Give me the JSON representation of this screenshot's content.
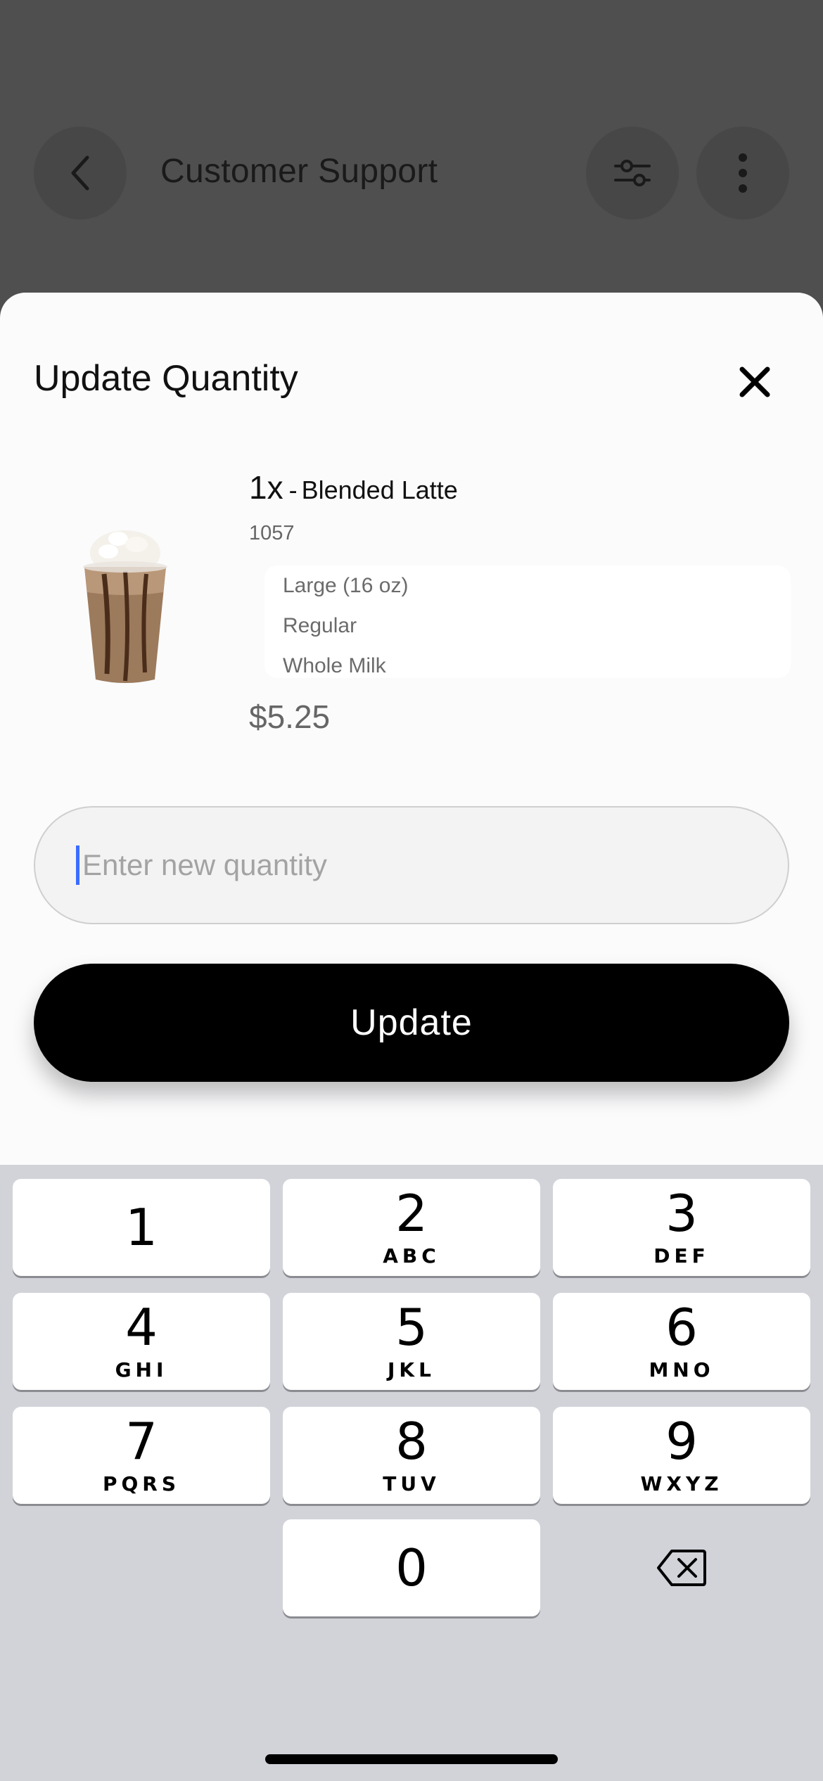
{
  "header": {
    "title": "Customer Support",
    "back_icon": "chevron-left-icon",
    "filter_icon": "sliders-icon",
    "more_icon": "more-vertical-icon"
  },
  "sheet": {
    "title": "Update Quantity",
    "close_icon": "close-icon",
    "item": {
      "quantity": "1x",
      "separator": "-",
      "name": "Blended Latte",
      "code": "1057",
      "options": [
        "Large (16 oz)",
        "Regular",
        "Whole Milk"
      ],
      "price": "$5.25"
    },
    "input": {
      "value": "",
      "placeholder": "Enter new quantity"
    },
    "update_label": "Update"
  },
  "keyboard": {
    "keys": [
      {
        "num": "1",
        "letters": ""
      },
      {
        "num": "2",
        "letters": "ABC"
      },
      {
        "num": "3",
        "letters": "DEF"
      },
      {
        "num": "4",
        "letters": "GHI"
      },
      {
        "num": "5",
        "letters": "JKL"
      },
      {
        "num": "6",
        "letters": "MNO"
      },
      {
        "num": "7",
        "letters": "PQRS"
      },
      {
        "num": "8",
        "letters": "TUV"
      },
      {
        "num": "9",
        "letters": "WXYZ"
      },
      {
        "num": "0",
        "letters": ""
      }
    ],
    "backspace_icon": "backspace-icon"
  },
  "colors": {
    "overlay": "#4f4f4f",
    "sheet_bg": "#fbfbfc",
    "button_bg": "#000000",
    "caret": "#3b6cff",
    "keyboard_bg": "#d1d3d9"
  }
}
